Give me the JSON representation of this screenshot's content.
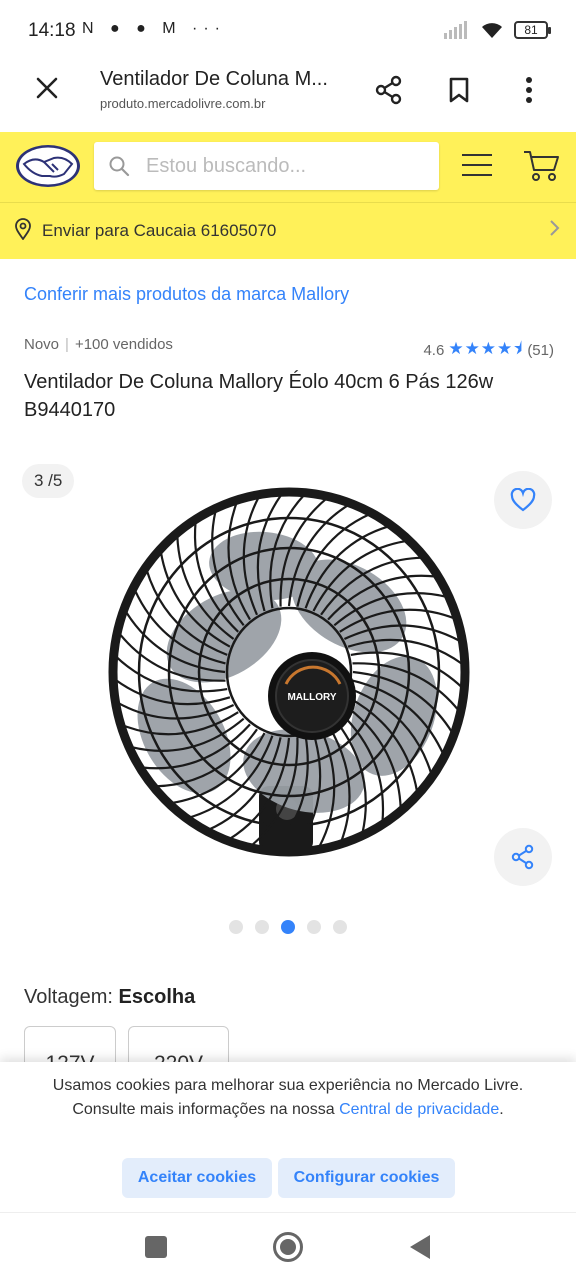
{
  "status_bar": {
    "time": "14:18",
    "notification_icons": "N ● ● M ···",
    "battery": "81"
  },
  "browser": {
    "title": "Ventilador De Coluna M...",
    "url": "produto.mercadolivre.com.br"
  },
  "header": {
    "search_placeholder": "Estou buscando...",
    "brand_color": "#fff159"
  },
  "shipping": {
    "text": "Enviar para Caucaia 61605070"
  },
  "product": {
    "brand_link": "Conferir mais produtos da marca Mallory",
    "condition": "Novo",
    "sold": "+100 vendidos",
    "rating_value": "4.6",
    "rating_count": "(51)",
    "stars": "★★★★⯨",
    "title": "Ventilador De Coluna Mallory Éolo 40cm 6 Pás 126w B9440170",
    "logo_text": "MALLORY"
  },
  "gallery": {
    "counter": "3 /5",
    "total": 5,
    "active_index": 3
  },
  "voltage": {
    "label": "Voltagem:",
    "selection": "Escolha",
    "options": [
      "127V",
      "220V"
    ]
  },
  "cookies": {
    "text": "Usamos cookies para melhorar sua experiência no Mercado Livre. Consulte mais informações na nossa",
    "link": "Central de privacidade",
    "after_link": ".",
    "accept": "Aceitar cookies",
    "configure": "Configurar cookies"
  },
  "colors": {
    "accent": "#3483fa",
    "header_yellow": "#fff159"
  }
}
